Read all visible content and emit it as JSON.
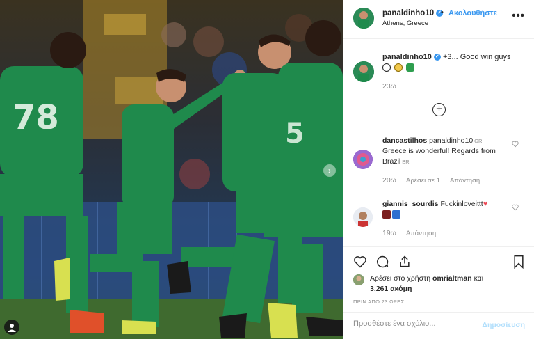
{
  "post": {
    "username": "panaldinho10",
    "follow_label": "Ακολουθήστε",
    "location": "Athens, Greece",
    "caption_text": "+3... Good win guys",
    "caption_emojis": [
      "soccer-ball",
      "grinning-face",
      "shamrock"
    ],
    "caption_time": "23ω"
  },
  "comments": [
    {
      "username": "dancastilhos",
      "mention": "panaldinho10",
      "flag1": "GR",
      "text": "Greece is wonderful! Regards from Brazil",
      "flag2": "BR",
      "time": "20ω",
      "likes": "Αρέσει σε 1",
      "reply": "Απάντηση"
    },
    {
      "username": "giannis_sourdis",
      "text": "Fuckinloveittt",
      "time": "19ω",
      "reply": "Απάντηση"
    }
  ],
  "likes": {
    "prefix": "Αρέσει στο χρήστη",
    "user": "omrialtman",
    "conj": "και",
    "count": "3,261 ακόμη"
  },
  "posted_time": "ΠΡΙΝ ΑΠΟ 23 ΩΡΕΣ",
  "comment_box": {
    "placeholder": "Προσθέστε ένα σχόλιο...",
    "post_label": "Δημοσίευση"
  },
  "colors": {
    "accent": "#3897f0",
    "kit_green": "#1f8a4c",
    "heart_red": "#ed4956"
  },
  "icons": [
    "more-icon",
    "add-comment-icon",
    "heart-icon",
    "comment-icon",
    "share-icon",
    "bookmark-icon",
    "user-tag-icon",
    "next-arrow-icon"
  ]
}
